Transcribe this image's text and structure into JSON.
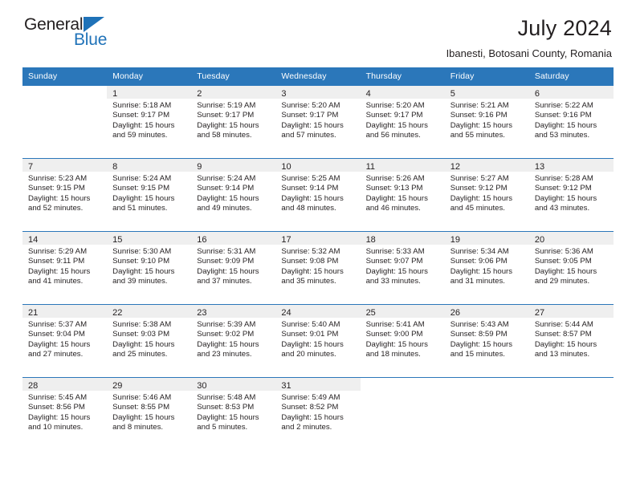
{
  "logo": {
    "word_primary": "General",
    "word_secondary": "Blue",
    "triangle_color": "#1f72b8"
  },
  "header": {
    "month_title": "July 2024",
    "location": "Ibanesti, Botosani County, Romania"
  },
  "theme": {
    "header_blue": "#2b77ba",
    "daynum_band": "#efefef",
    "text": "#231f20"
  },
  "weekday_headers": [
    "Sunday",
    "Monday",
    "Tuesday",
    "Wednesday",
    "Thursday",
    "Friday",
    "Saturday"
  ],
  "weeks": [
    [
      {
        "day": "",
        "sunrise": "",
        "sunset": "",
        "daylight_1": "",
        "daylight_2": ""
      },
      {
        "day": "1",
        "sunrise": "Sunrise: 5:18 AM",
        "sunset": "Sunset: 9:17 PM",
        "daylight_1": "Daylight: 15 hours",
        "daylight_2": "and 59 minutes."
      },
      {
        "day": "2",
        "sunrise": "Sunrise: 5:19 AM",
        "sunset": "Sunset: 9:17 PM",
        "daylight_1": "Daylight: 15 hours",
        "daylight_2": "and 58 minutes."
      },
      {
        "day": "3",
        "sunrise": "Sunrise: 5:20 AM",
        "sunset": "Sunset: 9:17 PM",
        "daylight_1": "Daylight: 15 hours",
        "daylight_2": "and 57 minutes."
      },
      {
        "day": "4",
        "sunrise": "Sunrise: 5:20 AM",
        "sunset": "Sunset: 9:17 PM",
        "daylight_1": "Daylight: 15 hours",
        "daylight_2": "and 56 minutes."
      },
      {
        "day": "5",
        "sunrise": "Sunrise: 5:21 AM",
        "sunset": "Sunset: 9:16 PM",
        "daylight_1": "Daylight: 15 hours",
        "daylight_2": "and 55 minutes."
      },
      {
        "day": "6",
        "sunrise": "Sunrise: 5:22 AM",
        "sunset": "Sunset: 9:16 PM",
        "daylight_1": "Daylight: 15 hours",
        "daylight_2": "and 53 minutes."
      }
    ],
    [
      {
        "day": "7",
        "sunrise": "Sunrise: 5:23 AM",
        "sunset": "Sunset: 9:15 PM",
        "daylight_1": "Daylight: 15 hours",
        "daylight_2": "and 52 minutes."
      },
      {
        "day": "8",
        "sunrise": "Sunrise: 5:24 AM",
        "sunset": "Sunset: 9:15 PM",
        "daylight_1": "Daylight: 15 hours",
        "daylight_2": "and 51 minutes."
      },
      {
        "day": "9",
        "sunrise": "Sunrise: 5:24 AM",
        "sunset": "Sunset: 9:14 PM",
        "daylight_1": "Daylight: 15 hours",
        "daylight_2": "and 49 minutes."
      },
      {
        "day": "10",
        "sunrise": "Sunrise: 5:25 AM",
        "sunset": "Sunset: 9:14 PM",
        "daylight_1": "Daylight: 15 hours",
        "daylight_2": "and 48 minutes."
      },
      {
        "day": "11",
        "sunrise": "Sunrise: 5:26 AM",
        "sunset": "Sunset: 9:13 PM",
        "daylight_1": "Daylight: 15 hours",
        "daylight_2": "and 46 minutes."
      },
      {
        "day": "12",
        "sunrise": "Sunrise: 5:27 AM",
        "sunset": "Sunset: 9:12 PM",
        "daylight_1": "Daylight: 15 hours",
        "daylight_2": "and 45 minutes."
      },
      {
        "day": "13",
        "sunrise": "Sunrise: 5:28 AM",
        "sunset": "Sunset: 9:12 PM",
        "daylight_1": "Daylight: 15 hours",
        "daylight_2": "and 43 minutes."
      }
    ],
    [
      {
        "day": "14",
        "sunrise": "Sunrise: 5:29 AM",
        "sunset": "Sunset: 9:11 PM",
        "daylight_1": "Daylight: 15 hours",
        "daylight_2": "and 41 minutes."
      },
      {
        "day": "15",
        "sunrise": "Sunrise: 5:30 AM",
        "sunset": "Sunset: 9:10 PM",
        "daylight_1": "Daylight: 15 hours",
        "daylight_2": "and 39 minutes."
      },
      {
        "day": "16",
        "sunrise": "Sunrise: 5:31 AM",
        "sunset": "Sunset: 9:09 PM",
        "daylight_1": "Daylight: 15 hours",
        "daylight_2": "and 37 minutes."
      },
      {
        "day": "17",
        "sunrise": "Sunrise: 5:32 AM",
        "sunset": "Sunset: 9:08 PM",
        "daylight_1": "Daylight: 15 hours",
        "daylight_2": "and 35 minutes."
      },
      {
        "day": "18",
        "sunrise": "Sunrise: 5:33 AM",
        "sunset": "Sunset: 9:07 PM",
        "daylight_1": "Daylight: 15 hours",
        "daylight_2": "and 33 minutes."
      },
      {
        "day": "19",
        "sunrise": "Sunrise: 5:34 AM",
        "sunset": "Sunset: 9:06 PM",
        "daylight_1": "Daylight: 15 hours",
        "daylight_2": "and 31 minutes."
      },
      {
        "day": "20",
        "sunrise": "Sunrise: 5:36 AM",
        "sunset": "Sunset: 9:05 PM",
        "daylight_1": "Daylight: 15 hours",
        "daylight_2": "and 29 minutes."
      }
    ],
    [
      {
        "day": "21",
        "sunrise": "Sunrise: 5:37 AM",
        "sunset": "Sunset: 9:04 PM",
        "daylight_1": "Daylight: 15 hours",
        "daylight_2": "and 27 minutes."
      },
      {
        "day": "22",
        "sunrise": "Sunrise: 5:38 AM",
        "sunset": "Sunset: 9:03 PM",
        "daylight_1": "Daylight: 15 hours",
        "daylight_2": "and 25 minutes."
      },
      {
        "day": "23",
        "sunrise": "Sunrise: 5:39 AM",
        "sunset": "Sunset: 9:02 PM",
        "daylight_1": "Daylight: 15 hours",
        "daylight_2": "and 23 minutes."
      },
      {
        "day": "24",
        "sunrise": "Sunrise: 5:40 AM",
        "sunset": "Sunset: 9:01 PM",
        "daylight_1": "Daylight: 15 hours",
        "daylight_2": "and 20 minutes."
      },
      {
        "day": "25",
        "sunrise": "Sunrise: 5:41 AM",
        "sunset": "Sunset: 9:00 PM",
        "daylight_1": "Daylight: 15 hours",
        "daylight_2": "and 18 minutes."
      },
      {
        "day": "26",
        "sunrise": "Sunrise: 5:43 AM",
        "sunset": "Sunset: 8:59 PM",
        "daylight_1": "Daylight: 15 hours",
        "daylight_2": "and 15 minutes."
      },
      {
        "day": "27",
        "sunrise": "Sunrise: 5:44 AM",
        "sunset": "Sunset: 8:57 PM",
        "daylight_1": "Daylight: 15 hours",
        "daylight_2": "and 13 minutes."
      }
    ],
    [
      {
        "day": "28",
        "sunrise": "Sunrise: 5:45 AM",
        "sunset": "Sunset: 8:56 PM",
        "daylight_1": "Daylight: 15 hours",
        "daylight_2": "and 10 minutes."
      },
      {
        "day": "29",
        "sunrise": "Sunrise: 5:46 AM",
        "sunset": "Sunset: 8:55 PM",
        "daylight_1": "Daylight: 15 hours",
        "daylight_2": "and 8 minutes."
      },
      {
        "day": "30",
        "sunrise": "Sunrise: 5:48 AM",
        "sunset": "Sunset: 8:53 PM",
        "daylight_1": "Daylight: 15 hours",
        "daylight_2": "and 5 minutes."
      },
      {
        "day": "31",
        "sunrise": "Sunrise: 5:49 AM",
        "sunset": "Sunset: 8:52 PM",
        "daylight_1": "Daylight: 15 hours",
        "daylight_2": "and 2 minutes."
      },
      {
        "day": "",
        "sunrise": "",
        "sunset": "",
        "daylight_1": "",
        "daylight_2": ""
      },
      {
        "day": "",
        "sunrise": "",
        "sunset": "",
        "daylight_1": "",
        "daylight_2": ""
      },
      {
        "day": "",
        "sunrise": "",
        "sunset": "",
        "daylight_1": "",
        "daylight_2": ""
      }
    ]
  ]
}
